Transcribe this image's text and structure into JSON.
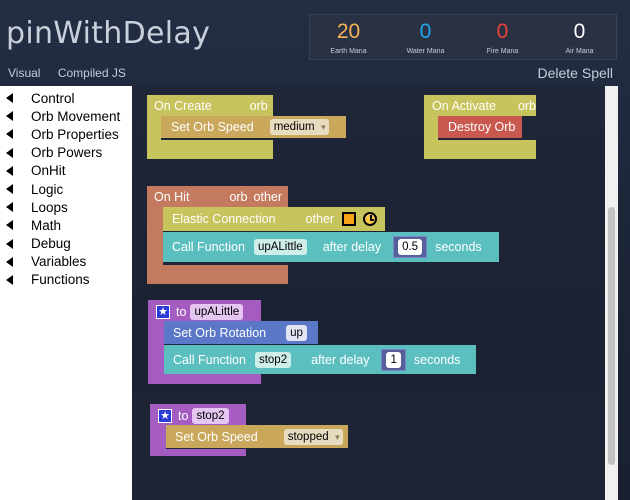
{
  "title": "pinWithDelay",
  "mana": [
    {
      "value": "20",
      "label": "Earth Mana",
      "color": "#f7b35a"
    },
    {
      "value": "0",
      "label": "Water Mana",
      "color": "#1ea6e8"
    },
    {
      "value": "0",
      "label": "Fire Mana",
      "color": "#e8433b"
    },
    {
      "value": "0",
      "label": "Air Mana",
      "color": "#ffffff"
    }
  ],
  "tabs": {
    "visual": "Visual",
    "compiled": "Compiled JS"
  },
  "delete_spell": "Delete Spell",
  "categories": [
    "Control",
    "Orb Movement",
    "Orb Properties",
    "Orb Powers",
    "OnHit",
    "Logic",
    "Loops",
    "Math",
    "Debug",
    "Variables",
    "Functions"
  ],
  "blocks": {
    "on_create": {
      "label": "On Create",
      "param": "orb",
      "set_speed": "Set Orb Speed",
      "speed_value": "medium"
    },
    "on_activate": {
      "label": "On Activate",
      "param": "orb",
      "destroy": "Destroy Orb"
    },
    "on_hit": {
      "label": "On Hit",
      "param1": "orb",
      "param2": "other",
      "elastic": "Elastic Connection",
      "elastic_arg": "other",
      "call": "Call Function",
      "func": "upALittle",
      "after_delay": "after delay",
      "delay": "0.5",
      "seconds": "seconds"
    },
    "fn_up": {
      "to": "to",
      "name": "upALittle",
      "rotation": "Set Orb Rotation",
      "rotation_value": "up",
      "call": "Call Function",
      "func": "stop2",
      "after_delay": "after delay",
      "delay": "1",
      "seconds": "seconds"
    },
    "fn_stop": {
      "to": "to",
      "name": "stop2",
      "set_speed": "Set Orb Speed",
      "speed_value": "stopped"
    }
  },
  "colors": {
    "event_block": "#c7c35d",
    "action_block": "#c9a85c",
    "destroy_block": "#c9584f",
    "onhit_block": "#c47a5e",
    "elastic_block": "#c7c35d",
    "call_block": "#5bbfc0",
    "function_block": "#a55cc1",
    "rotation_block": "#5a78c7"
  }
}
